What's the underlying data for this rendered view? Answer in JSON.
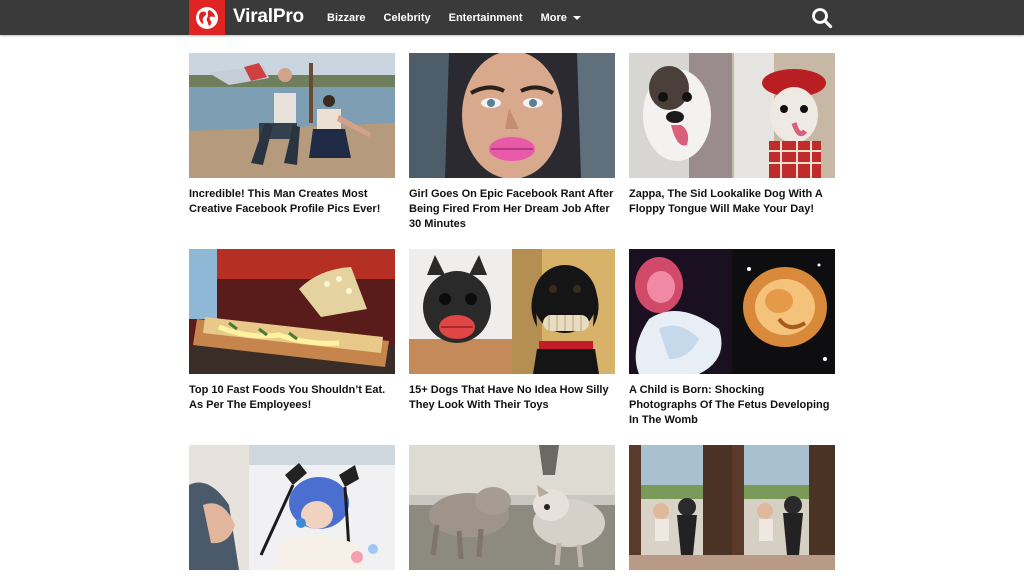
{
  "header": {
    "brand": "ViralPro",
    "nav": [
      {
        "label": "Bizzare"
      },
      {
        "label": "Celebrity"
      },
      {
        "label": "Entertainment"
      },
      {
        "label": "More"
      }
    ],
    "colors": {
      "bar": "#3a3a3a",
      "logo": "#e02424"
    },
    "icons": {
      "logo": "globe-icon",
      "search": "search-icon",
      "more": "chevron-down-icon"
    }
  },
  "articles": [
    {
      "title": "Incredible! This Man Creates Most Creative Facebook Profile Pics Ever!"
    },
    {
      "title": "Girl Goes On Epic Facebook Rant After Being Fired From Her Dream Job After 30 Minutes"
    },
    {
      "title": "Zappa, The Sid Lookalike Dog With A Floppy Tongue Will Make Your Day!"
    },
    {
      "title": "Top 10 Fast Foods You Shouldn’t Eat. As Per The Employees!"
    },
    {
      "title": "15+ Dogs That Have No Idea How Silly They Look With Their Toys"
    },
    {
      "title": "A Child is Born: Shocking Photographs Of The Fetus Developing In The Womb"
    },
    {
      "title": ""
    },
    {
      "title": ""
    },
    {
      "title": ""
    }
  ]
}
